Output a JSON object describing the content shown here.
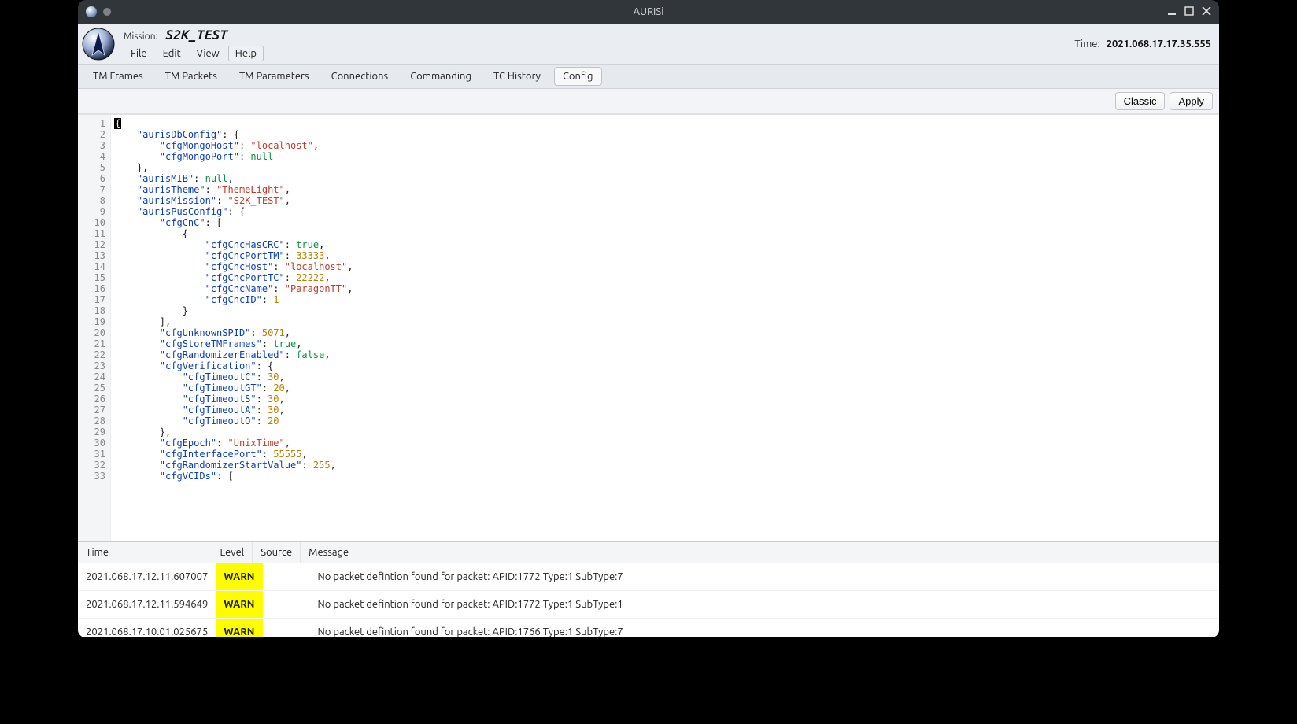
{
  "window": {
    "title": "AURISi"
  },
  "header": {
    "mission_label": "Mission:",
    "mission_value": "S2K_TEST",
    "time_label": "Time:",
    "time_value": "2021.068.17.17.35.555",
    "menu": {
      "file": "File",
      "edit": "Edit",
      "view": "View",
      "help": "Help"
    }
  },
  "tabs": {
    "items": [
      "TM Frames",
      "TM Packets",
      "TM Parameters",
      "Connections",
      "Commanding",
      "TC History",
      "Config"
    ],
    "active_index": 6
  },
  "toolbar": {
    "classic": "Classic",
    "apply": "Apply"
  },
  "editor": {
    "line_count": 33,
    "tokens": [
      [
        {
          "t": "firstbrace",
          "v": "{"
        }
      ],
      [
        {
          "t": "pad",
          "v": "    "
        },
        {
          "t": "k",
          "v": "\"aurisDbConfig\""
        },
        {
          "t": "p",
          "v": ": {"
        }
      ],
      [
        {
          "t": "pad",
          "v": "        "
        },
        {
          "t": "k",
          "v": "\"cfgMongoHost\""
        },
        {
          "t": "p",
          "v": ": "
        },
        {
          "t": "s",
          "v": "\"localhost\""
        },
        {
          "t": "p",
          "v": ","
        }
      ],
      [
        {
          "t": "pad",
          "v": "        "
        },
        {
          "t": "k",
          "v": "\"cfgMongoPort\""
        },
        {
          "t": "p",
          "v": ": "
        },
        {
          "t": "b",
          "v": "null"
        }
      ],
      [
        {
          "t": "pad",
          "v": "    "
        },
        {
          "t": "p",
          "v": "},"
        }
      ],
      [
        {
          "t": "pad",
          "v": "    "
        },
        {
          "t": "k",
          "v": "\"aurisMIB\""
        },
        {
          "t": "p",
          "v": ": "
        },
        {
          "t": "b",
          "v": "null"
        },
        {
          "t": "p",
          "v": ","
        }
      ],
      [
        {
          "t": "pad",
          "v": "    "
        },
        {
          "t": "k",
          "v": "\"aurisTheme\""
        },
        {
          "t": "p",
          "v": ": "
        },
        {
          "t": "s",
          "v": "\"ThemeLight\""
        },
        {
          "t": "p",
          "v": ","
        }
      ],
      [
        {
          "t": "pad",
          "v": "    "
        },
        {
          "t": "k",
          "v": "\"aurisMission\""
        },
        {
          "t": "p",
          "v": ": "
        },
        {
          "t": "s",
          "v": "\"S2K_TEST\""
        },
        {
          "t": "p",
          "v": ","
        }
      ],
      [
        {
          "t": "pad",
          "v": "    "
        },
        {
          "t": "k",
          "v": "\"aurisPusConfig\""
        },
        {
          "t": "p",
          "v": ": {"
        }
      ],
      [
        {
          "t": "pad",
          "v": "        "
        },
        {
          "t": "k",
          "v": "\"cfgCnC\""
        },
        {
          "t": "p",
          "v": ": ["
        }
      ],
      [
        {
          "t": "pad",
          "v": "            "
        },
        {
          "t": "p",
          "v": "{"
        }
      ],
      [
        {
          "t": "pad",
          "v": "                "
        },
        {
          "t": "k",
          "v": "\"cfgCncHasCRC\""
        },
        {
          "t": "p",
          "v": ": "
        },
        {
          "t": "b",
          "v": "true"
        },
        {
          "t": "p",
          "v": ","
        }
      ],
      [
        {
          "t": "pad",
          "v": "                "
        },
        {
          "t": "k",
          "v": "\"cfgCncPortTM\""
        },
        {
          "t": "p",
          "v": ": "
        },
        {
          "t": "n",
          "v": "33333"
        },
        {
          "t": "p",
          "v": ","
        }
      ],
      [
        {
          "t": "pad",
          "v": "                "
        },
        {
          "t": "k",
          "v": "\"cfgCncHost\""
        },
        {
          "t": "p",
          "v": ": "
        },
        {
          "t": "s",
          "v": "\"localhost\""
        },
        {
          "t": "p",
          "v": ","
        }
      ],
      [
        {
          "t": "pad",
          "v": "                "
        },
        {
          "t": "k",
          "v": "\"cfgCncPortTC\""
        },
        {
          "t": "p",
          "v": ": "
        },
        {
          "t": "n",
          "v": "22222"
        },
        {
          "t": "p",
          "v": ","
        }
      ],
      [
        {
          "t": "pad",
          "v": "                "
        },
        {
          "t": "k",
          "v": "\"cfgCncName\""
        },
        {
          "t": "p",
          "v": ": "
        },
        {
          "t": "s",
          "v": "\"ParagonTT\""
        },
        {
          "t": "p",
          "v": ","
        }
      ],
      [
        {
          "t": "pad",
          "v": "                "
        },
        {
          "t": "k",
          "v": "\"cfgCncID\""
        },
        {
          "t": "p",
          "v": ": "
        },
        {
          "t": "n",
          "v": "1"
        }
      ],
      [
        {
          "t": "pad",
          "v": "            "
        },
        {
          "t": "p",
          "v": "}"
        }
      ],
      [
        {
          "t": "pad",
          "v": "        "
        },
        {
          "t": "p",
          "v": "],"
        }
      ],
      [
        {
          "t": "pad",
          "v": "        "
        },
        {
          "t": "k",
          "v": "\"cfgUnknownSPID\""
        },
        {
          "t": "p",
          "v": ": "
        },
        {
          "t": "n",
          "v": "5071"
        },
        {
          "t": "p",
          "v": ","
        }
      ],
      [
        {
          "t": "pad",
          "v": "        "
        },
        {
          "t": "k",
          "v": "\"cfgStoreTMFrames\""
        },
        {
          "t": "p",
          "v": ": "
        },
        {
          "t": "b",
          "v": "true"
        },
        {
          "t": "p",
          "v": ","
        }
      ],
      [
        {
          "t": "pad",
          "v": "        "
        },
        {
          "t": "k",
          "v": "\"cfgRandomizerEnabled\""
        },
        {
          "t": "p",
          "v": ": "
        },
        {
          "t": "b",
          "v": "false"
        },
        {
          "t": "p",
          "v": ","
        }
      ],
      [
        {
          "t": "pad",
          "v": "        "
        },
        {
          "t": "k",
          "v": "\"cfgVerification\""
        },
        {
          "t": "p",
          "v": ": {"
        }
      ],
      [
        {
          "t": "pad",
          "v": "            "
        },
        {
          "t": "k",
          "v": "\"cfgTimeoutC\""
        },
        {
          "t": "p",
          "v": ": "
        },
        {
          "t": "n",
          "v": "30"
        },
        {
          "t": "p",
          "v": ","
        }
      ],
      [
        {
          "t": "pad",
          "v": "            "
        },
        {
          "t": "k",
          "v": "\"cfgTimeoutGT\""
        },
        {
          "t": "p",
          "v": ": "
        },
        {
          "t": "n",
          "v": "20"
        },
        {
          "t": "p",
          "v": ","
        }
      ],
      [
        {
          "t": "pad",
          "v": "            "
        },
        {
          "t": "k",
          "v": "\"cfgTimeoutS\""
        },
        {
          "t": "p",
          "v": ": "
        },
        {
          "t": "n",
          "v": "30"
        },
        {
          "t": "p",
          "v": ","
        }
      ],
      [
        {
          "t": "pad",
          "v": "            "
        },
        {
          "t": "k",
          "v": "\"cfgTimeoutA\""
        },
        {
          "t": "p",
          "v": ": "
        },
        {
          "t": "n",
          "v": "30"
        },
        {
          "t": "p",
          "v": ","
        }
      ],
      [
        {
          "t": "pad",
          "v": "            "
        },
        {
          "t": "k",
          "v": "\"cfgTimeoutO\""
        },
        {
          "t": "p",
          "v": ": "
        },
        {
          "t": "n",
          "v": "20"
        }
      ],
      [
        {
          "t": "pad",
          "v": "        "
        },
        {
          "t": "p",
          "v": "},"
        }
      ],
      [
        {
          "t": "pad",
          "v": "        "
        },
        {
          "t": "k",
          "v": "\"cfgEpoch\""
        },
        {
          "t": "p",
          "v": ": "
        },
        {
          "t": "s",
          "v": "\"UnixTime\""
        },
        {
          "t": "p",
          "v": ","
        }
      ],
      [
        {
          "t": "pad",
          "v": "        "
        },
        {
          "t": "k",
          "v": "\"cfgInterfacePort\""
        },
        {
          "t": "p",
          "v": ": "
        },
        {
          "t": "n",
          "v": "55555"
        },
        {
          "t": "p",
          "v": ","
        }
      ],
      [
        {
          "t": "pad",
          "v": "        "
        },
        {
          "t": "k",
          "v": "\"cfgRandomizerStartValue\""
        },
        {
          "t": "p",
          "v": ": "
        },
        {
          "t": "n",
          "v": "255"
        },
        {
          "t": "p",
          "v": ","
        }
      ],
      [
        {
          "t": "pad",
          "v": "        "
        },
        {
          "t": "k",
          "v": "\"cfgVCIDs\""
        },
        {
          "t": "p",
          "v": ": ["
        }
      ]
    ]
  },
  "log": {
    "headers": {
      "time": "Time",
      "level": "Level",
      "source": "Source",
      "message": "Message"
    },
    "rows": [
      {
        "time": "2021.068.17.12.11.607007",
        "level": "WARN",
        "source": "",
        "message": "No packet defintion found for packet: APID:1772 Type:1 SubType:7"
      },
      {
        "time": "2021.068.17.12.11.594649",
        "level": "WARN",
        "source": "",
        "message": "No packet defintion found for packet: APID:1772 Type:1 SubType:1"
      },
      {
        "time": "2021.068.17.10.01.025675",
        "level": "WARN",
        "source": "",
        "message": "No packet defintion found for packet: APID:1766 Type:1 SubType:7"
      }
    ]
  }
}
